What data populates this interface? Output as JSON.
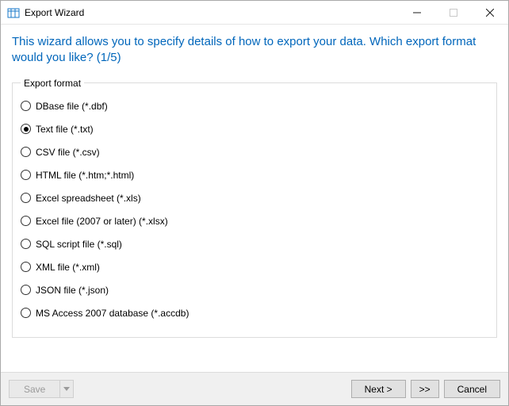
{
  "window": {
    "title": "Export Wizard"
  },
  "instruction": "This wizard allows you to specify details of how to export your data. Which export format would you like? (1/5)",
  "group": {
    "legend": "Export format",
    "selected_index": 1,
    "options": [
      "DBase file (*.dbf)",
      "Text file (*.txt)",
      "CSV file (*.csv)",
      "HTML file (*.htm;*.html)",
      "Excel spreadsheet (*.xls)",
      "Excel file (2007 or later) (*.xlsx)",
      "SQL script file (*.sql)",
      "XML file (*.xml)",
      "JSON file (*.json)",
      "MS Access 2007 database (*.accdb)"
    ]
  },
  "footer": {
    "save": "Save",
    "next": "Next >",
    "fast_forward": ">>",
    "cancel": "Cancel"
  },
  "icons": {
    "app": "export-wizard-icon",
    "minimize": "minimize-icon",
    "maximize": "maximize-icon",
    "close": "close-icon",
    "dropdown": "chevron-down-icon"
  }
}
